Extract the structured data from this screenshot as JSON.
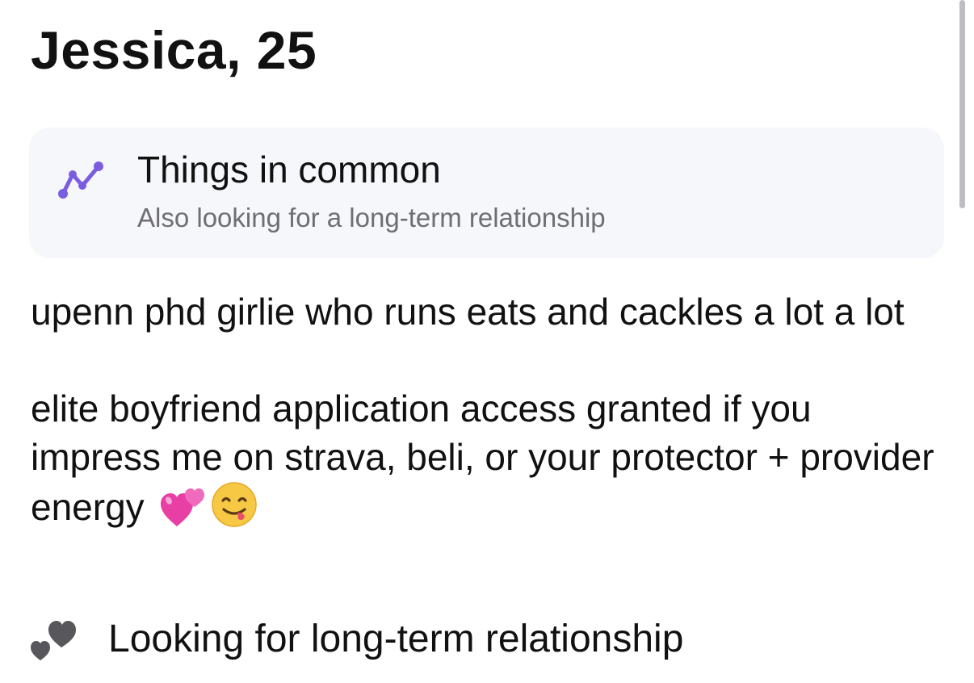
{
  "profile": {
    "heading": "Jessica, 25"
  },
  "things_in_common": {
    "icon": "connection-graph-icon",
    "title": "Things in common",
    "subtitle": "Also looking for a long-term relationship",
    "accent_color": "#7b5ee0"
  },
  "bio": {
    "paragraph_1": "upenn phd girlie who runs eats and cackles a lot a lot",
    "paragraph_2": "elite boyfriend application access granted if you impress me on strava, beli, or your protector + provider energy",
    "emojis": [
      "two-hearts-emoji",
      "yum-face-emoji"
    ]
  },
  "relationship_goal": {
    "icon": "two-hearts-icon",
    "label": "Looking for long-term relationship",
    "icon_color": "#58585c"
  }
}
